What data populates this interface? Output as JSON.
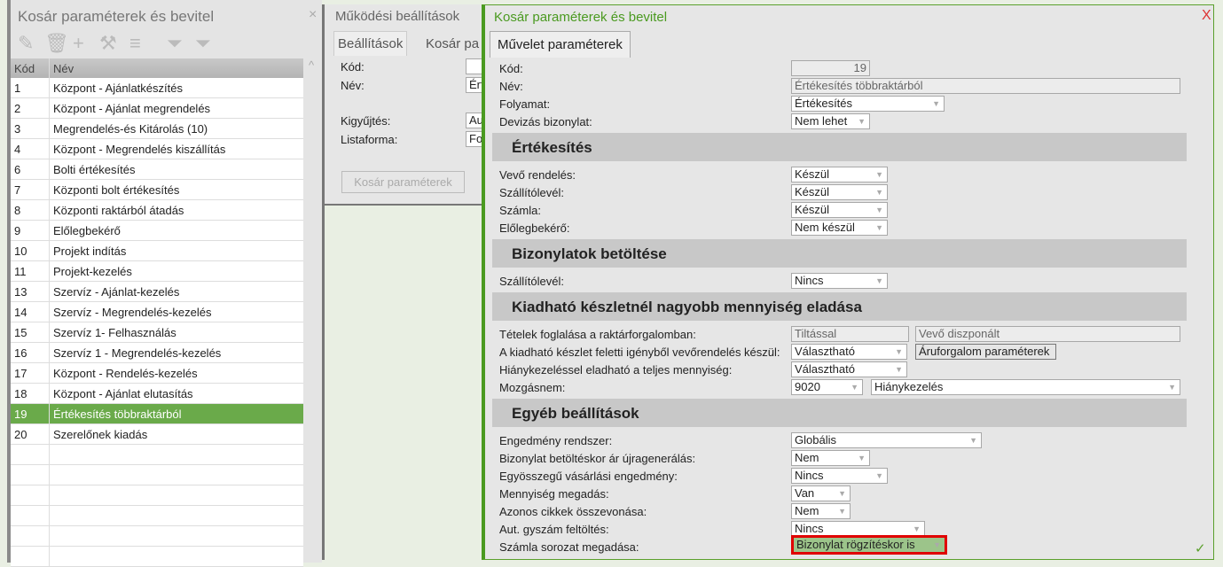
{
  "left": {
    "title": "Kosár paraméterek és bevitel",
    "close": "×",
    "toolbar": [
      "pencil-icon",
      "trash-icon",
      "plus-icon",
      "tools-icon",
      "list-icon",
      "filter-icon",
      "filter-clear-icon"
    ],
    "columns": [
      "Kód",
      "Név"
    ],
    "rows": [
      [
        "1",
        "Központ - Ajánlatkészítés"
      ],
      [
        "2",
        "Központ - Ajánlat megrendelés"
      ],
      [
        "3",
        "Megrendelés-és Kitárolás (10)"
      ],
      [
        "4",
        "Központ - Megrendelés kiszállítás"
      ],
      [
        "6",
        "Bolti értékesítés"
      ],
      [
        "7",
        "Központi bolt értékesítés"
      ],
      [
        "8",
        "Központi raktárból átadás"
      ],
      [
        "9",
        "Előlegbekérő"
      ],
      [
        "10",
        "Projekt indítás"
      ],
      [
        "11",
        "Projekt-kezelés"
      ],
      [
        "13",
        "Szervíz - Ajánlat-kezelés"
      ],
      [
        "14",
        "Szervíz - Megrendelés-kezelés"
      ],
      [
        "15",
        "Szervíz 1- Felhasználás"
      ],
      [
        "16",
        "Szervíz 1 - Megrendelés-kezelés"
      ],
      [
        "17",
        "Központ - Rendelés-kezelés"
      ],
      [
        "18",
        "Központ - Ajánlat elutasítás"
      ],
      [
        "19",
        "Értékesítés többraktárból"
      ],
      [
        "20",
        "Szerelőnek kiadás"
      ]
    ],
    "selected": "19"
  },
  "mid": {
    "title": "Működési beállítások",
    "tabs": [
      "Beállítások",
      "Kosár pa"
    ],
    "labels": [
      "Kód:",
      "Név:",
      "Kigyűjtés:",
      "Listaforma:"
    ],
    "values": [
      "",
      "Ért",
      "Aut",
      "For"
    ],
    "button": "Kosár paraméterek"
  },
  "dialog": {
    "title": "Kosár paraméterek és bevitel",
    "close": "X",
    "tab": "Művelet paraméterek",
    "kod_label": "Kód:",
    "kod": "19",
    "nev_label": "Név:",
    "nev": "Értékesítés többraktárból",
    "folyamat_label": "Folyamat:",
    "folyamat": "Értékesítés",
    "deviza_label": "Devizás bizonylat:",
    "deviza": "Nem lehet",
    "sec1": "Értékesítés",
    "vevo_label": "Vevő rendelés:",
    "vevo": "Készül",
    "szall_label": "Szállítólevél:",
    "szall": "Készül",
    "szamla_label": "Számla:",
    "szamla": "Készül",
    "eloleg_label": "Előlegbekérő:",
    "eloleg": "Nem készül",
    "sec2": "Bizonylatok betöltése",
    "szall2_label": "Szállítólevél:",
    "szall2": "Nincs",
    "sec3": "Kiadható készletnél nagyobb mennyiség eladása",
    "tetel_label": "Tételek foglalása a raktárforgalomban:",
    "tetel1": "Tiltással",
    "tetel2": "Vevő diszponált",
    "kiad_label": "A kiadható készlet feletti igényből vevőrendelés készül:",
    "kiad": "Választható",
    "aru_button": "Áruforgalom paraméterek",
    "hiany_label": "Hiánykezeléssel eladható a teljes mennyiség:",
    "hiany": "Választható",
    "mozg_label": "Mozgásnem:",
    "mozg1": "9020",
    "mozg2": "Hiánykezelés",
    "sec4": "Egyéb beállítások",
    "eng_label": "Engedmény rendszer:",
    "eng": "Globális",
    "bizar_label": "Bizonylat betöltéskor ár újragenerálás:",
    "bizar": "Nem",
    "egyo_label": "Egyösszegű vásárlási engedmény:",
    "egyo": "Nincs",
    "menny_label": "Mennyiség megadás:",
    "menny": "Van",
    "azon_label": "Azonos cikkek összevonása:",
    "azon": "Nem",
    "gysz_label": "Aut. gyszám feltöltés:",
    "gysz": "Nincs",
    "sorozat_label": "Számla sorozat megadása:",
    "sorozat": "Bizonylat rögzítéskor is",
    "ok": "✓"
  },
  "colors": {
    "accent": "#5aa02c",
    "selected_row": "#6aaa4a",
    "highlight": "#e00000"
  }
}
